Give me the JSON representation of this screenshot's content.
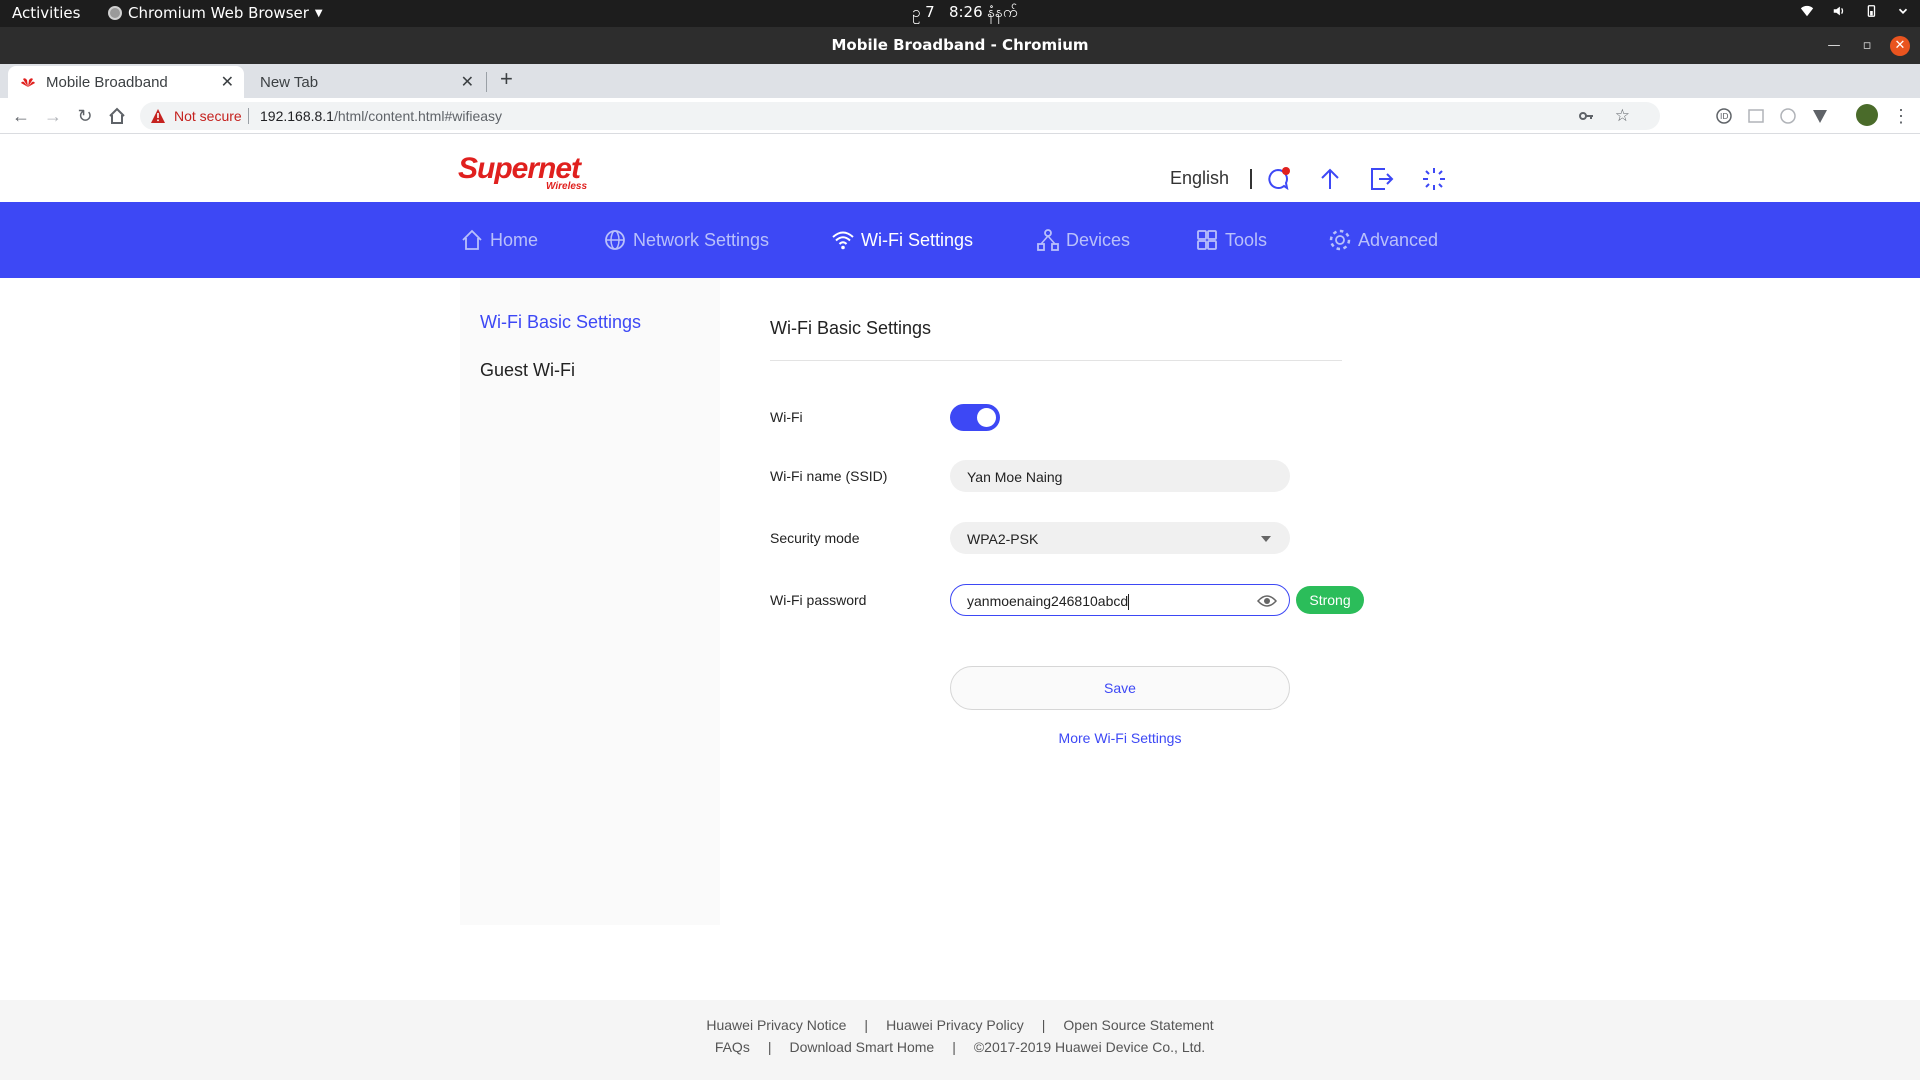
{
  "topbar": {
    "activities": "Activities",
    "app_name": "Chromium Web Browser",
    "clock_prefix": "ဥ 7",
    "clock": "8:26 နံနက်"
  },
  "window": {
    "title": "Mobile Broadband - Chromium"
  },
  "tabs": [
    {
      "label": "Mobile Broadband",
      "active": true
    },
    {
      "label": "New Tab",
      "active": false
    }
  ],
  "address": {
    "security_label": "Not secure",
    "url_host": "192.168.8.1",
    "url_path": "/html/content.html#wifieasy"
  },
  "header": {
    "logo_text": "Supernet",
    "logo_sub": "Wireless",
    "language": "English"
  },
  "nav": {
    "items": [
      {
        "label": "Home",
        "icon": "home-icon"
      },
      {
        "label": "Network Settings",
        "icon": "globe-icon"
      },
      {
        "label": "Wi-Fi Settings",
        "icon": "wifi-icon"
      },
      {
        "label": "Devices",
        "icon": "devices-icon"
      },
      {
        "label": "Tools",
        "icon": "tools-icon"
      },
      {
        "label": "Advanced",
        "icon": "gear-icon"
      }
    ]
  },
  "sidebar": {
    "items": [
      {
        "label": "Wi-Fi Basic Settings"
      },
      {
        "label": "Guest Wi-Fi"
      }
    ]
  },
  "content": {
    "title": "Wi-Fi Basic Settings",
    "wifi_label": "Wi-Fi",
    "ssid_label": "Wi-Fi name (SSID)",
    "ssid_value": "Yan Moe Naing",
    "security_label": "Security mode",
    "security_value": "WPA2-PSK",
    "password_label": "Wi-Fi password",
    "password_value": "yanmoenaing246810abcd",
    "strength": "Strong",
    "save_label": "Save",
    "more_link": "More Wi-Fi Settings"
  },
  "footer": {
    "row1": [
      "Huawei Privacy Notice",
      "Huawei Privacy Policy",
      "Open Source Statement"
    ],
    "row2": [
      "FAQs",
      "Download Smart Home",
      "©2017-2019 Huawei Device Co., Ltd."
    ]
  },
  "colors": {
    "nav_bg": "#3d48f5",
    "accent": "#3d48f5",
    "brand_red": "#e0201e",
    "strong_green": "#2bbd5a"
  }
}
